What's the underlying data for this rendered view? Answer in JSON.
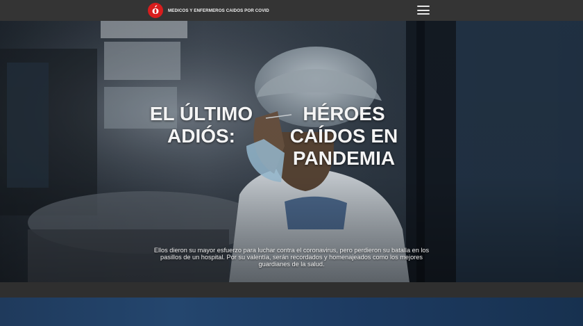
{
  "header": {
    "logo_glyph": "ó",
    "brand_text": "MEDICOS Y ENFERMEROS CAIDOS POR COVID",
    "menu_icon": "hamburger-menu-icon",
    "logo_color": "#d81d1d",
    "bar_color": "#343434"
  },
  "hero": {
    "title_left": "EL ÚLTIMO ADIÓS:",
    "title_right": "HÉROES CAÍDOS EN PANDEMIA",
    "description": "Ellos dieron su mayor esfuerzo para luchar contra el coronavirus, pero perdieron su batalla en los pasillos de un hospital. Por su valentía, serán recordados y homenajeados como los mejores guardianes de la salud."
  }
}
